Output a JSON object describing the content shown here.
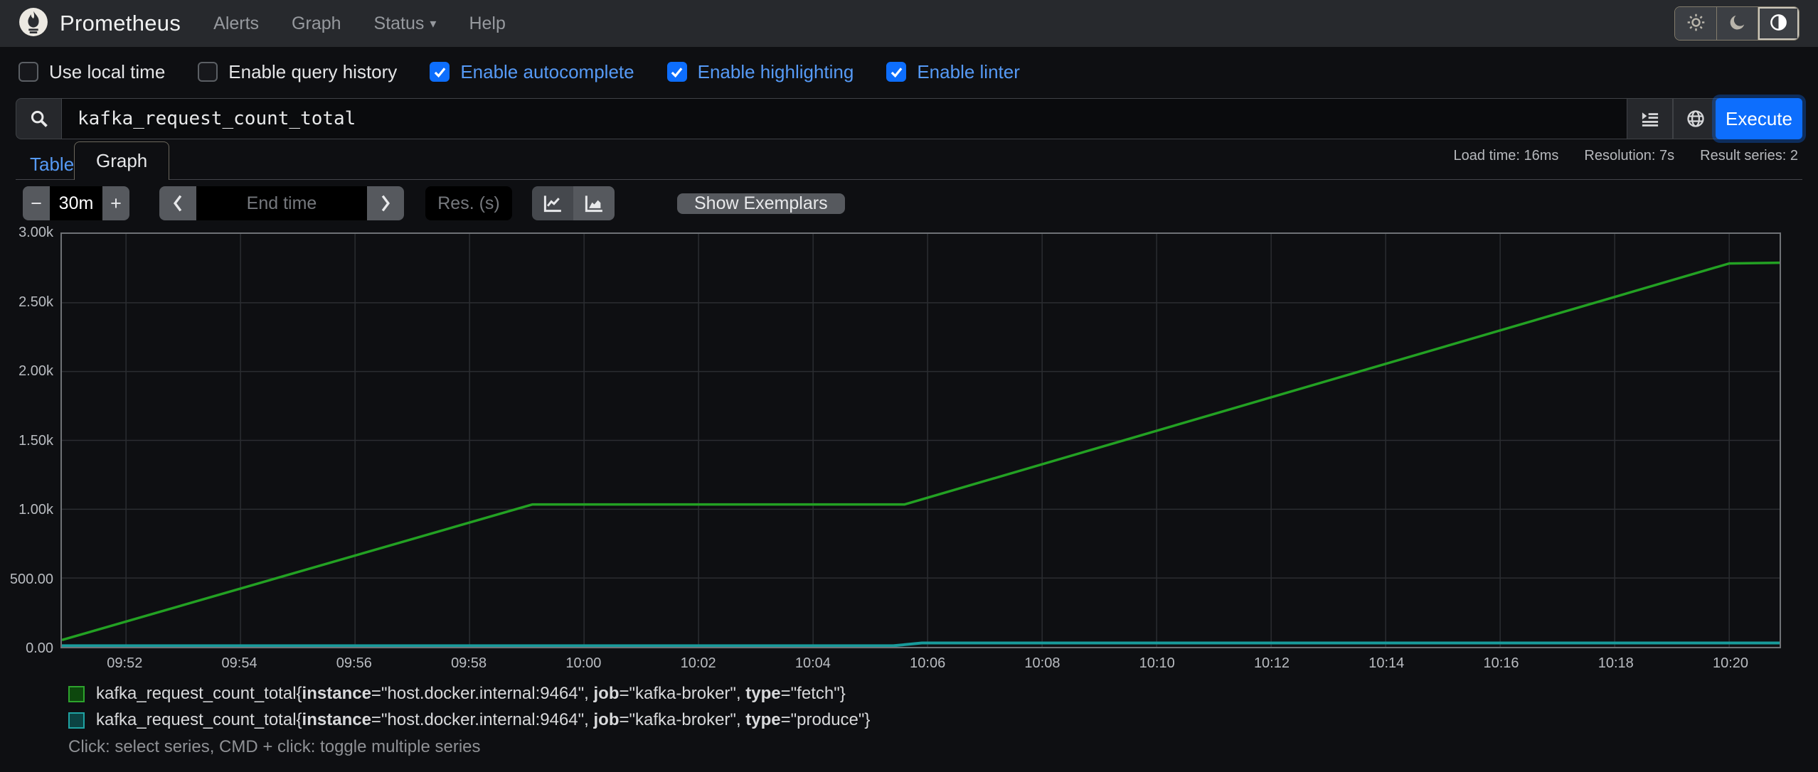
{
  "navbar": {
    "brand": "Prometheus",
    "items": [
      {
        "label": "Alerts",
        "caret": false
      },
      {
        "label": "Graph",
        "caret": false
      },
      {
        "label": "Status",
        "caret": true
      },
      {
        "label": "Help",
        "caret": false
      }
    ],
    "theme_buttons": [
      "sun-icon",
      "moon-icon",
      "auto-contrast-icon"
    ],
    "theme_active_index": 2
  },
  "options": [
    {
      "label": "Use local time",
      "checked": false
    },
    {
      "label": "Enable query history",
      "checked": false
    },
    {
      "label": "Enable autocomplete",
      "checked": true
    },
    {
      "label": "Enable highlighting",
      "checked": true
    },
    {
      "label": "Enable linter",
      "checked": true
    }
  ],
  "query": {
    "value": "kafka_request_count_total",
    "icons": [
      "search-icon",
      "format-expression-icon",
      "metrics-explorer-globe-icon"
    ],
    "execute_label": "Execute"
  },
  "tabs": {
    "table": "Table",
    "graph": "Graph"
  },
  "stats": {
    "load_time": "Load time: 16ms",
    "resolution": "Resolution: 7s",
    "result_series": "Result series: 2"
  },
  "controls": {
    "minus": "−",
    "plus": "+",
    "range_value": "30m",
    "end_time_placeholder": "End time",
    "res_placeholder": "Res. (s)",
    "chart_toggles": [
      "line-chart-icon",
      "stacked-chart-icon"
    ],
    "chart_toggle_active_index": 0,
    "show_exemplars": "Show Exemplars"
  },
  "chart_data": {
    "type": "line",
    "title": "kafka_request_count_total",
    "grid": true,
    "ylim": [
      0,
      3000
    ],
    "y_ticks": [
      {
        "label": "0.00",
        "v": 0
      },
      {
        "label": "500.00",
        "v": 500
      },
      {
        "label": "1.00k",
        "v": 1000
      },
      {
        "label": "1.50k",
        "v": 1500
      },
      {
        "label": "2.00k",
        "v": 2000
      },
      {
        "label": "2.50k",
        "v": 2500
      },
      {
        "label": "3.00k",
        "v": 3000
      }
    ],
    "x_domain_minutes_after_0950": [
      0.88,
      30.88
    ],
    "x_ticks": [
      {
        "label": "09:52",
        "t": 2
      },
      {
        "label": "09:54",
        "t": 4
      },
      {
        "label": "09:56",
        "t": 6
      },
      {
        "label": "09:58",
        "t": 8
      },
      {
        "label": "10:00",
        "t": 10
      },
      {
        "label": "10:02",
        "t": 12
      },
      {
        "label": "10:04",
        "t": 14
      },
      {
        "label": "10:06",
        "t": 16
      },
      {
        "label": "10:08",
        "t": 18
      },
      {
        "label": "10:10",
        "t": 20
      },
      {
        "label": "10:12",
        "t": 22
      },
      {
        "label": "10:14",
        "t": 24
      },
      {
        "label": "10:16",
        "t": 26
      },
      {
        "label": "10:18",
        "t": 28
      },
      {
        "label": "10:20",
        "t": 30
      }
    ],
    "series": [
      {
        "name": "kafka_request_count_total{instance=\"host.docker.internal:9464\", job=\"kafka-broker\", type=\"fetch\"}",
        "color": "#23a123",
        "width": 3.5,
        "points_t_v": [
          [
            0.88,
            50
          ],
          [
            9.1,
            1035
          ],
          [
            15.6,
            1035
          ],
          [
            30.0,
            2785
          ],
          [
            30.88,
            2790
          ]
        ]
      },
      {
        "name": "kafka_request_count_total{instance=\"host.docker.internal:9464\", job=\"kafka-broker\", type=\"produce\"}",
        "color": "#189b9b",
        "width": 4,
        "points_t_v": [
          [
            0.88,
            8
          ],
          [
            15.4,
            8
          ],
          [
            15.9,
            28
          ],
          [
            30.88,
            28
          ]
        ]
      }
    ]
  },
  "legend": {
    "series": [
      {
        "color": "#2da42d",
        "fill": "#0d470d",
        "segments": [
          [
            "kafka_request_count_total{",
            0
          ],
          [
            "instance",
            1
          ],
          [
            "=\"host.docker.internal:9464\", ",
            0
          ],
          [
            "job",
            1
          ],
          [
            "=\"kafka-broker\", ",
            0
          ],
          [
            "type",
            1
          ],
          [
            "=\"fetch\"}",
            0
          ]
        ]
      },
      {
        "color": "#1fa3a3",
        "fill": "#0b4343",
        "segments": [
          [
            "kafka_request_count_total{",
            0
          ],
          [
            "instance",
            1
          ],
          [
            "=\"host.docker.internal:9464\", ",
            0
          ],
          [
            "job",
            1
          ],
          [
            "=\"kafka-broker\", ",
            0
          ],
          [
            "type",
            1
          ],
          [
            "=\"produce\"}",
            0
          ]
        ]
      }
    ],
    "help": "Click: select series, CMD + click: toggle multiple series"
  }
}
